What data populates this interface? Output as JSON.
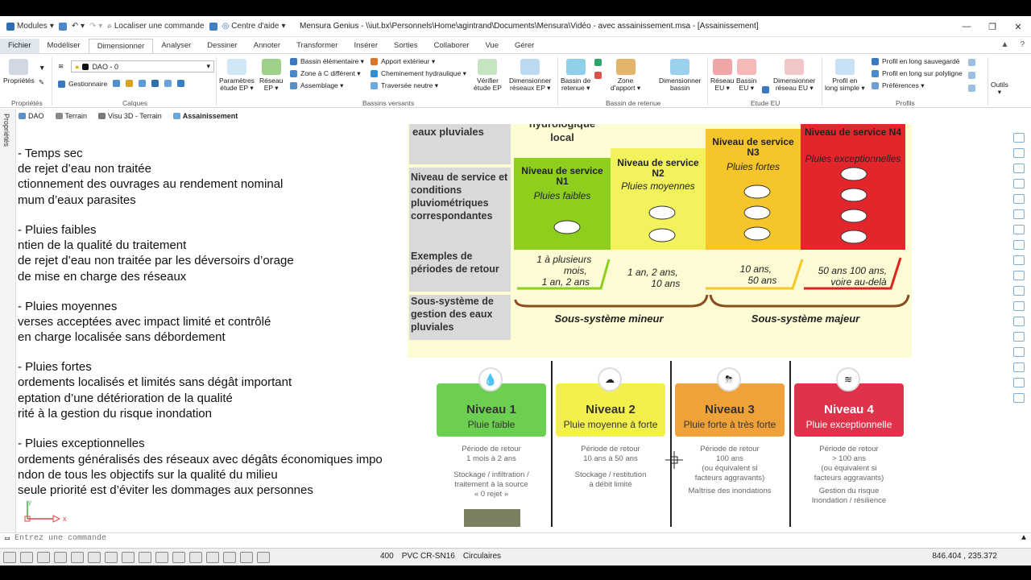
{
  "titlebar": {
    "modules_label": "Modules",
    "locate_command": "Localiser une commande",
    "help_center": "Centre d'aide",
    "title": "Mensura Genius - \\\\iut.bx\\Personnels\\Home\\agintrand\\Documents\\Mensura\\Vidéo - avec assainissement.msa - [Assainissement]"
  },
  "tabs": [
    "Fichier",
    "Modéliser",
    "Dimensionner",
    "Analyser",
    "Dessiner",
    "Annoter",
    "Transformer",
    "Insérer",
    "Sorties",
    "Collaborer",
    "Vue",
    "Gérer"
  ],
  "ribbon": {
    "proprietes": "Propriétés",
    "gestionnaire": "Gestionnaire",
    "layer_value": "DAO - 0",
    "parametres": [
      "Paramètres",
      "étude EP ▾"
    ],
    "reseau_ep": [
      "Réseau",
      "EP ▾"
    ],
    "bassin_elementaire": "Bassin élémentaire ▾",
    "zone_c": "Zone à C différent ▾",
    "assemblage": "Assemblage ▾",
    "apport_exterieur": "Apport extérieur ▾",
    "cheminement": "Cheminement hydraulique ▾",
    "traversee": "Traversée neutre ▾",
    "verifier": [
      "Vérifier",
      "étude EP"
    ],
    "dimensionner_reseaux_ep": [
      "Dimensionner",
      "réseaux EP ▾"
    ],
    "bassin_retenue": [
      "Bassin de",
      "retenue ▾"
    ],
    "zone_apport": [
      "Zone",
      "d'apport ▾"
    ],
    "dimensionner_bassin": [
      "Dimensionner",
      "bassin"
    ],
    "reseau_eu": [
      "Réseau",
      "EU ▾"
    ],
    "bassin_eu": [
      "Bassin",
      "EU ▾"
    ],
    "dimensionner_reseau_eu": [
      "Dimensionner",
      "réseau EU ▾"
    ],
    "profil_long": [
      "Profil en",
      "long simple ▾"
    ],
    "profil_sauvegarde": "Profil en long sauvegardé",
    "profil_polyligne": "Profil en long sur polyligne",
    "preferences": "Préférences ▾",
    "outils": "Outils",
    "groups": {
      "proprietes": "Propriétés",
      "calques": "Calques",
      "bassins_versants": "Bassins versants",
      "bassin_retenue": "Bassin de retenue",
      "etude_eu": "Etude EU",
      "profils": "Profils"
    }
  },
  "doc_tabs": [
    "DAO",
    "Terrain",
    "Visu 3D - Terrain",
    "Assainissement"
  ],
  "left_panel_label": "Propriétés",
  "text_lines": [
    "- Temps sec",
    " de rejet d’eau non traitée",
    "ctionnement des ouvrages au rendement nominal",
    "mum d’eaux parasites",
    "- Pluies faibles",
    "ntien de la qualité du traitement",
    " de rejet d’eau non traitée par les déversoirs d’orage",
    " de mise en charge des réseaux",
    "- Pluies moyennes",
    "verses acceptées avec impact limité et contrôlé",
    " en charge localisée sans débordement",
    "- Pluies fortes",
    "ordements localisés et limités sans dégât important",
    "eptation d’une détérioration de la qualité",
    "rité à la gestion du risque inondation",
    "- Pluies exceptionnelles",
    "ordements généralisés des réseaux avec dégâts économiques impo",
    "ndon de tous les objectifs sur la qualité du milieu",
    "seule priorité est d’éviter les dommages aux personnes"
  ],
  "table_top": {
    "row_labels": [
      "eaux pluviales",
      "Niveau de service et conditions pluviométriques correspondantes",
      "Exemples de périodes de retour",
      "Sous-système de gestion des eaux pluviales"
    ],
    "header_partial": [
      "hydrologique",
      "local"
    ],
    "levels": [
      {
        "name": "Niveau de service N1",
        "sub": "Pluies faibles",
        "period": [
          "1 à plusieurs",
          "mois,",
          "1 an, 2 ans"
        ],
        "color": "#8ecf1e"
      },
      {
        "name": "Niveau de service N2",
        "sub": "Pluies moyennes",
        "period": [
          "1 an, 2 ans,",
          "10 ans"
        ],
        "color": "#f2f25c"
      },
      {
        "name": "Niveau de service N3",
        "sub": "Pluies fortes",
        "period": [
          "10 ans,",
          "50 ans"
        ],
        "color": "#f5c52a"
      },
      {
        "name": "Niveau de service N4",
        "sub": "Pluies exceptionnelles",
        "period": [
          "50 ans 100 ans,",
          "voire au-delà"
        ],
        "color": "#e2262c"
      }
    ],
    "minor": "Sous-système mineur",
    "major": "Sous-système majeur"
  },
  "table_bottom": {
    "levels": [
      {
        "title": "Niveau 1",
        "sub": "Pluie faible",
        "desc": [
          "Période de retour",
          "1 mois à 2 ans",
          "",
          "Stockage / infiltration /",
          "traitement à la source",
          "« 0 rejet »"
        ],
        "color": "#6ccf52"
      },
      {
        "title": "Niveau 2",
        "sub": "Pluie moyenne à forte",
        "desc": [
          "Période de retour",
          "10 ans à 50 ans",
          "",
          "Stockage / restitution",
          "à débit limité"
        ],
        "color": "#f3ef4d"
      },
      {
        "title": "Niveau 3",
        "sub": "Pluie forte à très forte",
        "desc": [
          "Période de retour",
          "100 ans",
          "(ou équivalent si",
          "facteurs aggravants)",
          "Maîtrise des inondations"
        ],
        "color": "#f0a23a"
      },
      {
        "title": "Niveau 4",
        "sub": "Pluie exceptionnelle",
        "desc": [
          "Période de retour",
          "> 100 ans",
          "(ou équivalent si",
          "facteurs aggravants)",
          "Gestion du risque",
          "Inondation / résilience"
        ],
        "color": "#e0334b"
      }
    ]
  },
  "axis": {
    "x": "x",
    "y": "y"
  },
  "command": {
    "placeholder": "Entrez une commande"
  },
  "status": {
    "diameter": "400",
    "material": "PVC CR-SN16",
    "shape": "Circulaires",
    "coords": "846.404 , 235.372"
  }
}
